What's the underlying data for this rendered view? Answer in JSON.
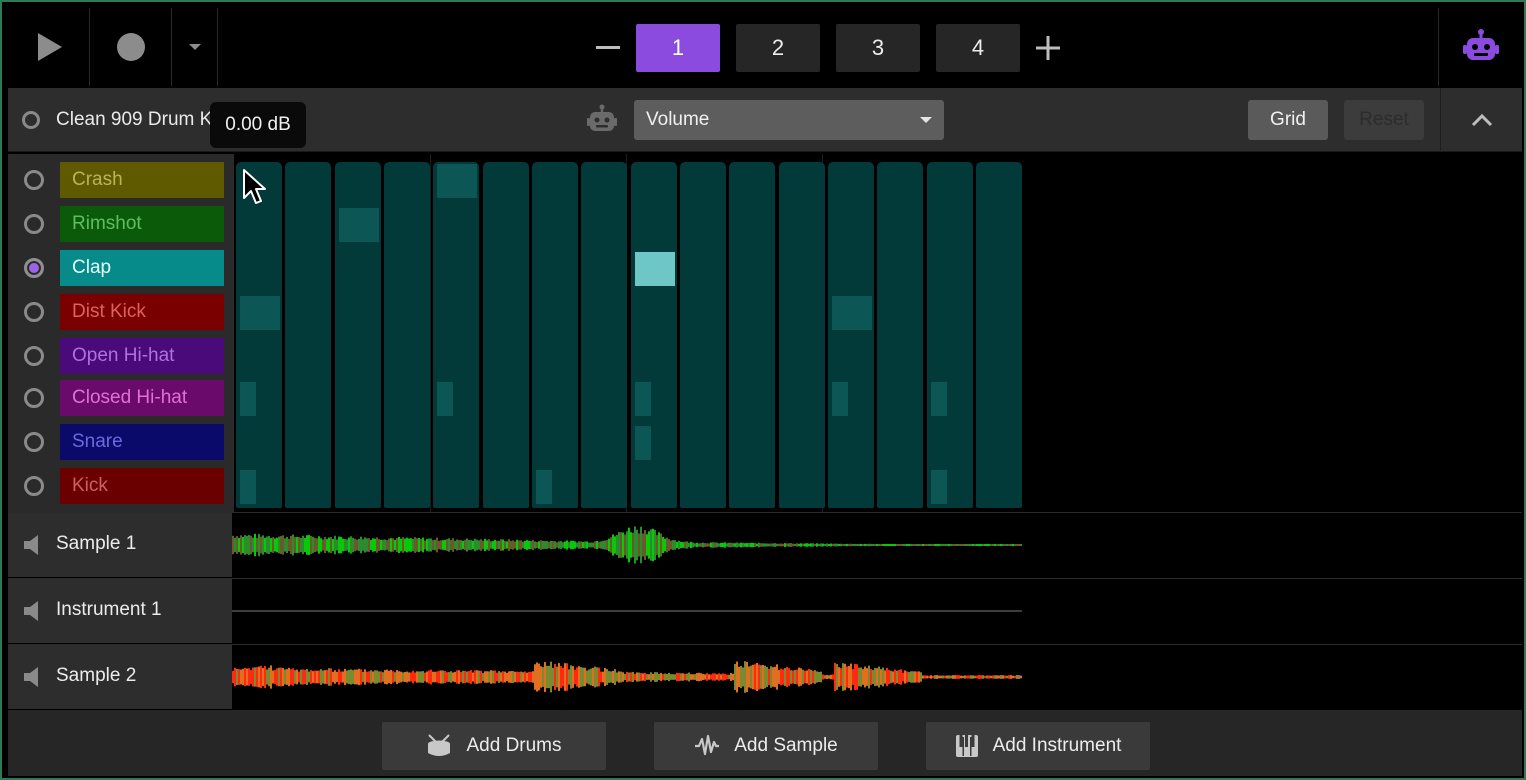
{
  "transport": {
    "play_icon": "play-icon",
    "record_icon": "record-icon",
    "menu_icon": "dropdown-caret-icon"
  },
  "patterns": {
    "remove_icon": "minus-icon",
    "add_icon": "plus-icon",
    "items": [
      {
        "label": "1",
        "active": true
      },
      {
        "label": "2",
        "active": false
      },
      {
        "label": "3",
        "active": false
      },
      {
        "label": "4",
        "active": false
      }
    ],
    "active_color": "#8a4bde"
  },
  "assistant": {
    "icon": "robot-icon",
    "color": "#8a4bde"
  },
  "kit": {
    "name": "Clean 909 Drum K",
    "tooltip": "0.00 dB",
    "parameter": "Volume",
    "grid_label": "Grid",
    "reset_label": "Reset",
    "collapse_icon": "chevron-up-icon"
  },
  "drums": [
    {
      "label": "Crash",
      "bg": "#5f5a00",
      "fg": "#b9b45a",
      "selected": false
    },
    {
      "label": "Rimshot",
      "bg": "#0a5a0a",
      "fg": "#5fbf5f",
      "selected": false
    },
    {
      "label": "Clap",
      "bg": "#068a8a",
      "fg": "#e8ffff",
      "selected": true
    },
    {
      "label": "Dist Kick",
      "bg": "#7a0000",
      "fg": "#e06060",
      "selected": false
    },
    {
      "label": "Open Hi-hat",
      "bg": "#4a0a7a",
      "fg": "#b070e0",
      "selected": false
    },
    {
      "label": "Closed Hi-hat",
      "bg": "#6a0a6a",
      "fg": "#e070d8",
      "selected": false
    },
    {
      "label": "Snare",
      "bg": "#0a0a6a",
      "fg": "#6a6ae0",
      "selected": false
    },
    {
      "label": "Kick",
      "bg": "#6a0000",
      "fg": "#d06060",
      "selected": false
    }
  ],
  "sequencer": {
    "steps": 16,
    "step_color": "#023a3a",
    "mark_color": "#0c5656",
    "hit_color": "#6ec6c6",
    "active_notes": [
      {
        "drum": "Clap",
        "step": 9
      }
    ]
  },
  "tracks": [
    {
      "name": "Sample 1",
      "icon": "speaker-icon",
      "wave_colors": [
        "#2e8a2e",
        "#6a5a2a",
        "#08c808"
      ]
    },
    {
      "name": "Instrument 1",
      "icon": "speaker-icon",
      "wave_colors": [
        "#666666"
      ]
    },
    {
      "name": "Sample 2",
      "icon": "speaker-icon",
      "wave_colors": [
        "#e07020",
        "#7a8a30",
        "#ff2a10"
      ]
    }
  ],
  "footer": {
    "buttons": [
      {
        "label": "Add Drums",
        "icon": "drum-icon"
      },
      {
        "label": "Add Sample",
        "icon": "waveform-icon"
      },
      {
        "label": "Add Instrument",
        "icon": "piano-keys-icon"
      }
    ]
  }
}
